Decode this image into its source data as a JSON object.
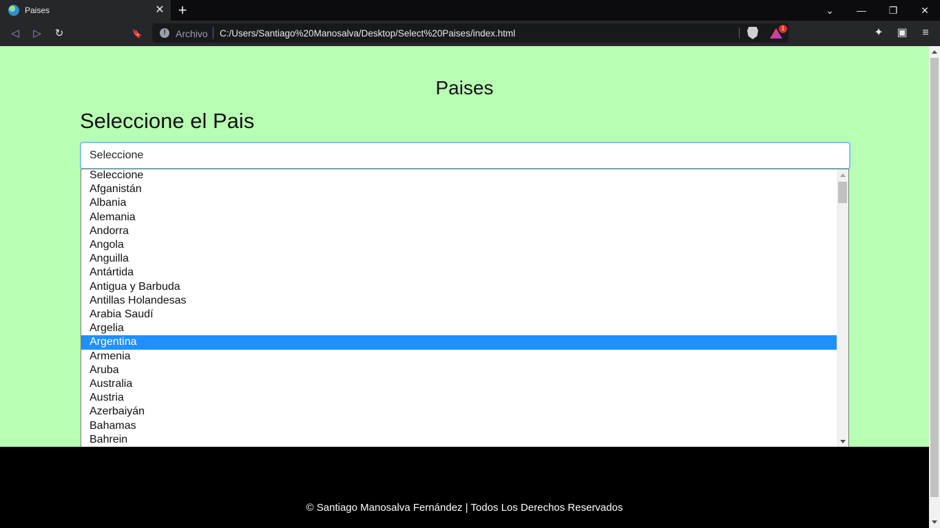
{
  "browser": {
    "tab": {
      "title": "Paises",
      "close": "✕"
    },
    "new_tab": "+",
    "window_buttons": {
      "chevron": "⌄",
      "minimize": "—",
      "restore": "❐",
      "close": "✕"
    },
    "nav": {
      "back": "◁",
      "forward": "▷",
      "reload": "↻",
      "bookmark": "🔖"
    },
    "address": {
      "scheme_label": "Archivo",
      "url": "C:/Users/Santiago%20Manosalva/Desktop/Select%20Paises/index.html",
      "rewards_badge": "1"
    },
    "toolbar_icons": {
      "extensions": "✦",
      "wallet": "▣",
      "menu": "≡"
    }
  },
  "page": {
    "title": "Paises",
    "heading": "Seleccione el Pais",
    "select": {
      "value": "Seleccione",
      "options": [
        "Seleccione",
        "Afganistán",
        "Albania",
        "Alemania",
        "Andorra",
        "Angola",
        "Anguilla",
        "Antártida",
        "Antigua y Barbuda",
        "Antillas Holandesas",
        "Arabia Saudí",
        "Argelia",
        "Argentina",
        "Armenia",
        "Aruba",
        "Australia",
        "Austria",
        "Azerbaiyán",
        "Bahamas",
        "Bahrein"
      ],
      "highlighted": "Argentina"
    },
    "footer": "© Santiago Manosalva Fernández | Todos Los Derechos Reservados"
  },
  "colors": {
    "page_bg": "#b8ffb3",
    "highlight": "#1e90ff",
    "footer_bg": "#000000"
  }
}
